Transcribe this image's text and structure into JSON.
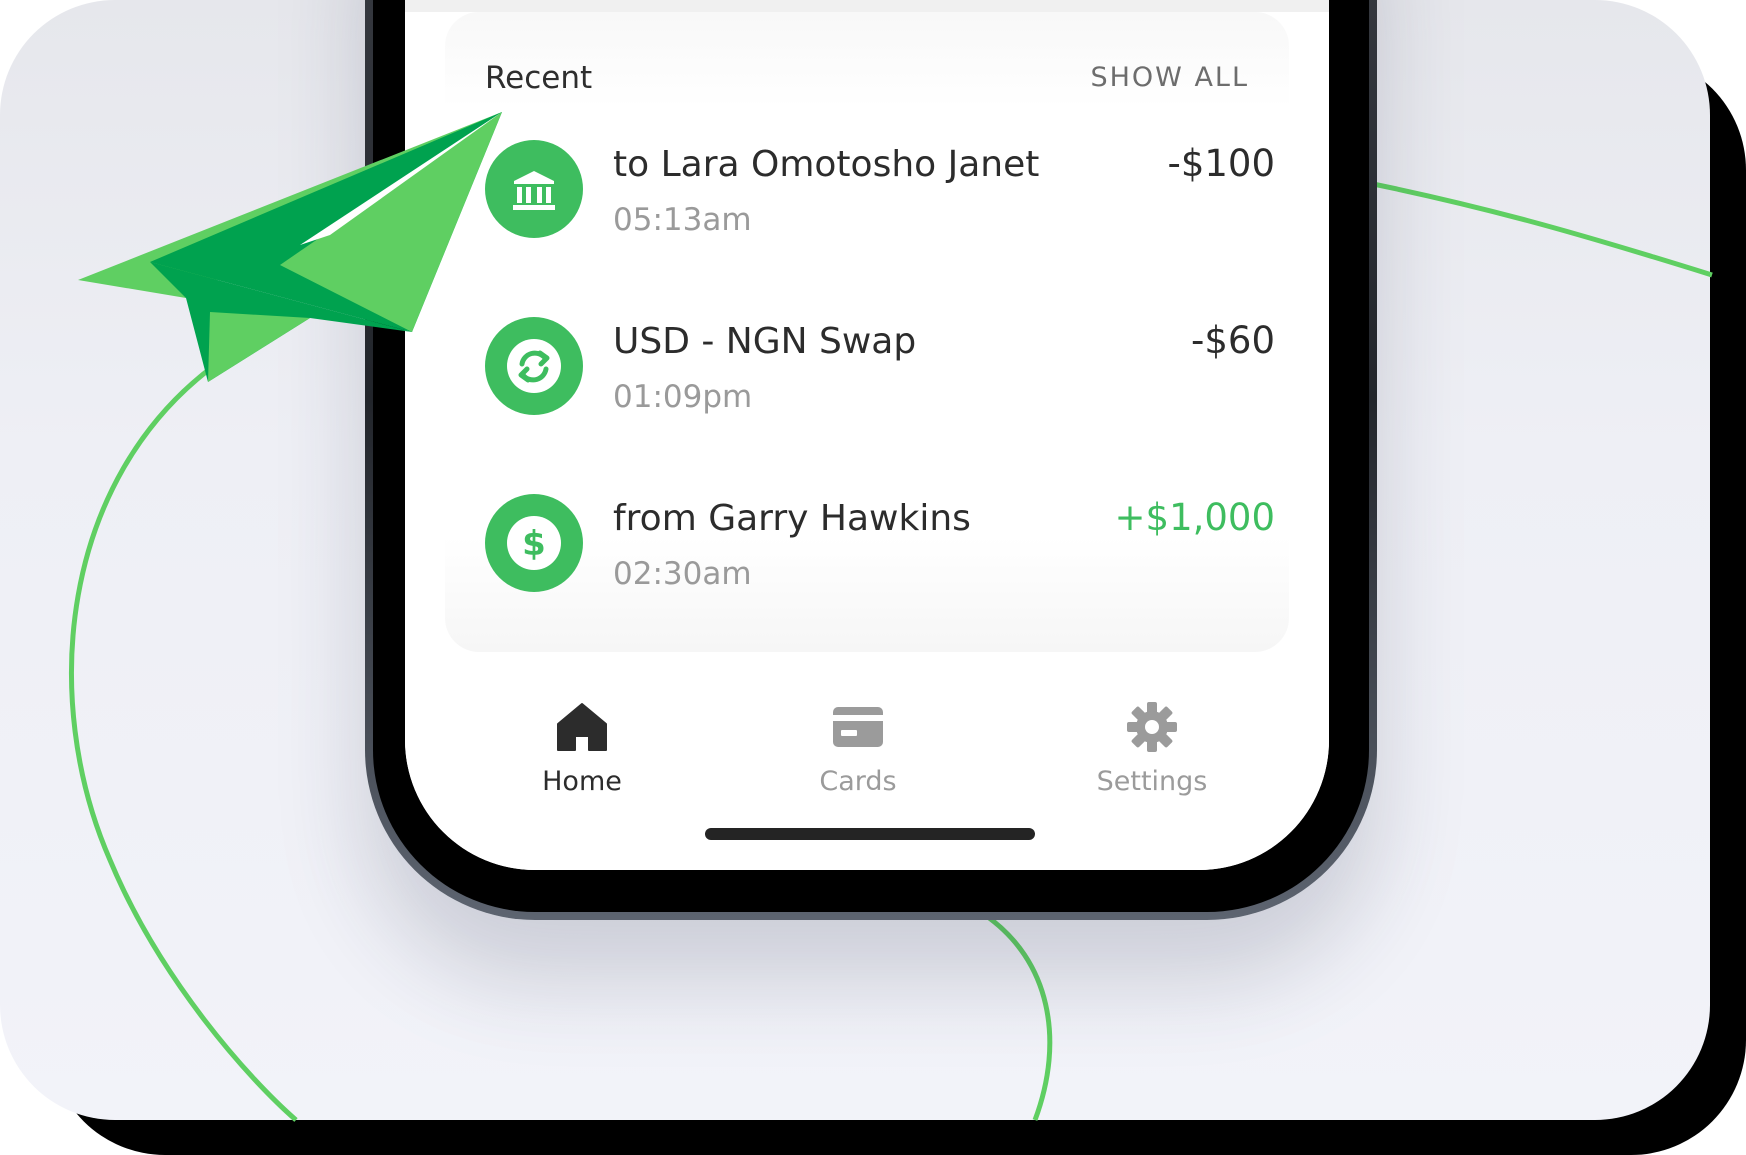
{
  "colors": {
    "accent": "#3ebd5f",
    "accent_dark": "#00a24f",
    "plane_light": "#5fcf62",
    "text_primary": "#2c2c2c",
    "text_secondary": "#9a9a9a",
    "background": "#eeeff5"
  },
  "recent": {
    "title": "Recent",
    "show_all": "SHOW ALL",
    "transactions": [
      {
        "name": "to Lara Omotosho Janet",
        "time": "05:13am",
        "amount": "-$100",
        "icon": "bank-icon",
        "direction": "outgoing"
      },
      {
        "name": "USD - NGN Swap",
        "time": "01:09pm",
        "amount": "-$60",
        "icon": "swap-icon",
        "direction": "outgoing"
      },
      {
        "name": "from Garry Hawkins",
        "time": "02:30am",
        "amount": "+$1,000",
        "icon": "dollar-icon",
        "direction": "incoming"
      }
    ]
  },
  "tabbar": {
    "items": [
      {
        "label": "Home",
        "icon": "home-icon",
        "active": true
      },
      {
        "label": "Cards",
        "icon": "card-icon",
        "active": false
      },
      {
        "label": "Settings",
        "icon": "gear-icon",
        "active": false
      }
    ]
  },
  "decoration": {
    "icon": "paper-plane-icon"
  }
}
